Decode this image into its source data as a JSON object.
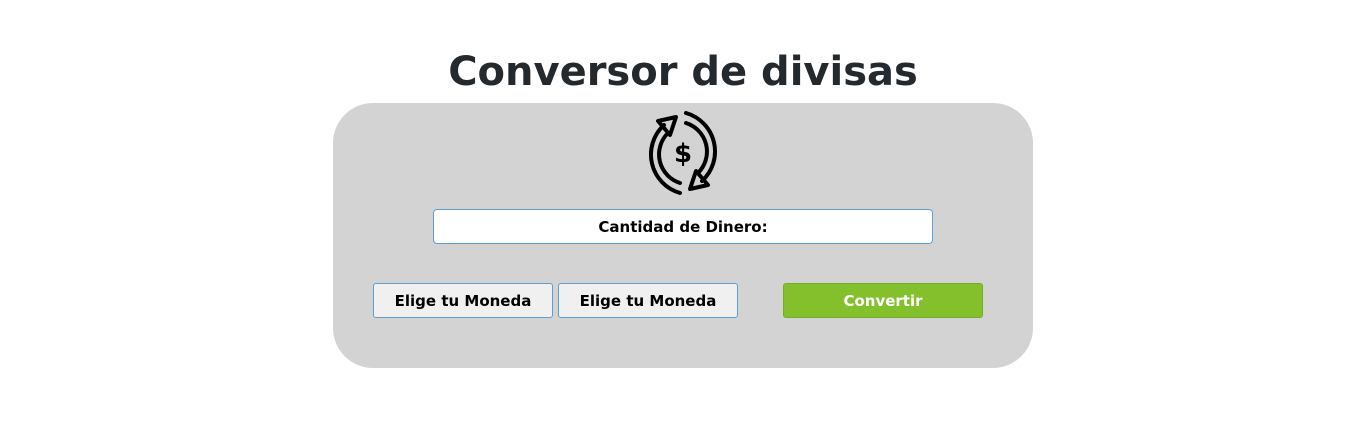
{
  "header": {
    "title": "Conversor de divisas"
  },
  "card": {
    "logo_icon": "currency-exchange-icon",
    "amount_input": {
      "placeholder": "Cantidad de Dinero:",
      "value": ""
    },
    "from_currency_label": "Elige tu Moneda",
    "to_currency_label": "Elige tu Moneda",
    "convert_label": "Convertir"
  },
  "colors": {
    "card_background": "#d3d3d3",
    "convert_button": "#84c02c",
    "input_border": "#5aa0d6",
    "title_text": "#24292e"
  }
}
